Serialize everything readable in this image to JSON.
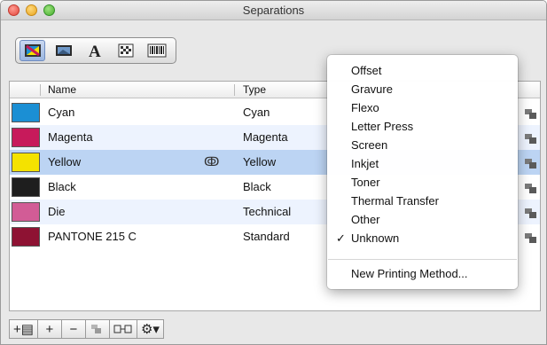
{
  "window": {
    "title": "Separations"
  },
  "toolbar": {
    "icons": [
      "swatch-view-icon",
      "image-view-icon",
      "text-view-icon",
      "pattern-view-icon",
      "barcode-view-icon"
    ]
  },
  "table": {
    "columns": [
      "Name",
      "Type"
    ],
    "rows": [
      {
        "name": "Cyan",
        "type": "Cyan",
        "color": "#1b8fd4"
      },
      {
        "name": "Magenta",
        "type": "Magenta",
        "color": "#c71a5b"
      },
      {
        "name": "Yellow",
        "type": "Yellow",
        "color": "#f4e200"
      },
      {
        "name": "Black",
        "type": "Black",
        "color": "#1e1e1e"
      },
      {
        "name": "Die",
        "type": "Technical",
        "color": "#d25c96"
      },
      {
        "name": "PANTONE 215 C",
        "type": "Standard",
        "color": "#8e1233"
      }
    ]
  },
  "menu": {
    "items": [
      "Offset",
      "Gravure",
      "Flexo",
      "Letter Press",
      "Screen",
      "Inkjet",
      "Toner",
      "Thermal Transfer",
      "Other",
      "Unknown"
    ],
    "checked": "✓",
    "footer": "New Printing Method..."
  },
  "bottom": {
    "add_group": "+▤",
    "add": "+",
    "remove": "−",
    "settings": "⚙▾"
  }
}
